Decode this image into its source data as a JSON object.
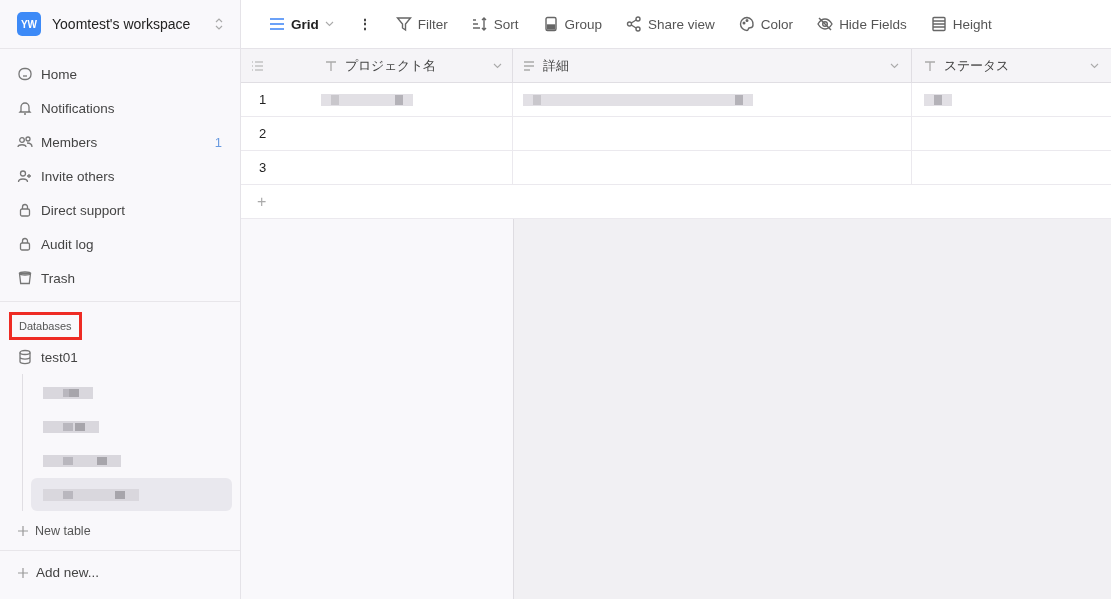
{
  "workspace": {
    "initials": "YW",
    "name": "Yoomtest's workspace"
  },
  "nav": [
    {
      "label": "Home"
    },
    {
      "label": "Notifications"
    },
    {
      "label": "Members",
      "count": "1"
    },
    {
      "label": "Invite others"
    },
    {
      "label": "Direct support"
    },
    {
      "label": "Audit log"
    },
    {
      "label": "Trash"
    }
  ],
  "databases": {
    "label": "Databases",
    "highlighted": true,
    "items": [
      {
        "name": "test01",
        "tables": [
          {
            "selected": false
          },
          {
            "selected": false
          },
          {
            "selected": false
          },
          {
            "selected": true
          }
        ]
      }
    ],
    "new_table": "New table"
  },
  "add_new": "Add new...",
  "toolbar": [
    {
      "label": "Grid"
    },
    {
      "label": "⋮"
    },
    {
      "label": "Filter"
    },
    {
      "label": "Sort"
    },
    {
      "label": "Group"
    },
    {
      "label": "Share view"
    },
    {
      "label": "Color"
    },
    {
      "label": "Hide Fields"
    },
    {
      "label": "Height"
    }
  ],
  "table": {
    "columns": [
      {
        "label": "プロジェクト名"
      },
      {
        "label": "詳細"
      },
      {
        "label": "ステータス"
      }
    ],
    "rows": [
      {
        "number": "1",
        "redacted": true
      },
      {
        "number": "2",
        "redacted": false
      },
      {
        "number": "3",
        "redacted": false
      }
    ],
    "add_row": "+"
  }
}
